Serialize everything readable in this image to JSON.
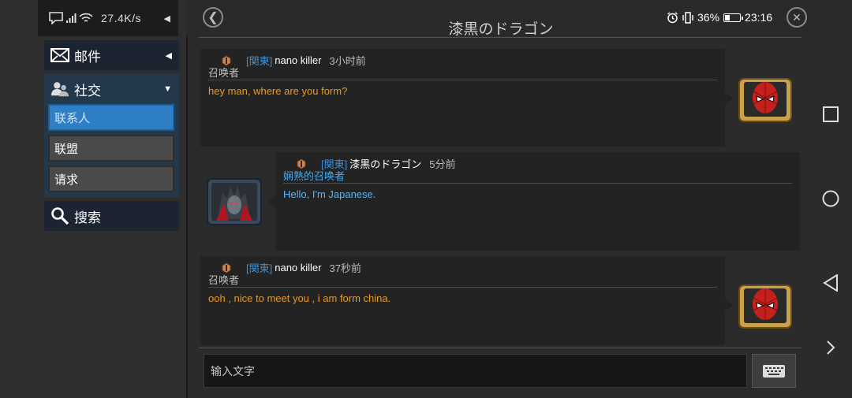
{
  "status": {
    "network_speed": "27.4K/s",
    "battery_pct": "36%",
    "clock": "23:16"
  },
  "sidebar": {
    "mail_label": "邮件",
    "social_label": "社交",
    "contacts_label": "联系人",
    "alliance_label": "联盟",
    "requests_label": "请求",
    "search_label": "搜索"
  },
  "chat": {
    "title": "漆黒のドラゴン",
    "messages": [
      {
        "region": "[関東]",
        "username": "nano killer",
        "time": "3小时前",
        "rank": "召唤者",
        "text": "hey man,  where are you form?"
      },
      {
        "region": "[関東]",
        "username": "漆黒のドラゴン",
        "time": "5分前",
        "rank": "娴熟的召唤者",
        "text": "Hello, I'm Japanese."
      },
      {
        "region": "[関東]",
        "username": "nano killer",
        "time": "37秒前",
        "rank": "召唤者",
        "text": "ooh , nice to meet you , i am form china."
      }
    ],
    "input_placeholder": "输入文字"
  },
  "colors": {
    "accent_blue": "#2f7fc6",
    "message_orange": "#e89a1e",
    "message_blue": "#5fb2ee",
    "region_blue": "#3f8fd6"
  },
  "icons": [
    "notification-icon",
    "signal-icon",
    "wifi-icon",
    "mail-icon",
    "social-icon",
    "search-icon",
    "back-icon",
    "close-icon",
    "alarm-icon",
    "vibrate-icon",
    "battery-icon",
    "keyboard-icon",
    "square-icon",
    "circle-icon",
    "triangle-icon",
    "chevron-right-icon"
  ]
}
